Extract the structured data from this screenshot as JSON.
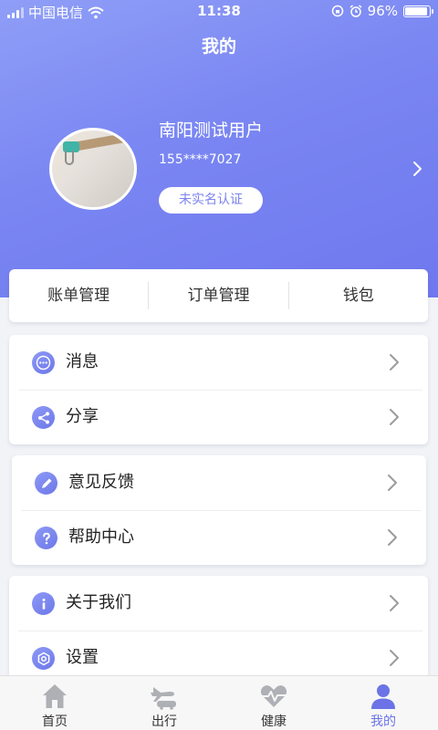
{
  "status_bar": {
    "carrier": "中国电信",
    "time": "11:38",
    "battery": "96%"
  },
  "header": {
    "title": "我的",
    "username": "南阳测试用户",
    "phone": "155****7027",
    "verify_label": "未实名认证"
  },
  "quick_actions": [
    {
      "label": "账单管理"
    },
    {
      "label": "订单管理"
    },
    {
      "label": "钱包"
    }
  ],
  "menu_groups": [
    {
      "items": [
        {
          "label": "消息",
          "icon": "message-icon"
        },
        {
          "label": "分享",
          "icon": "share-icon"
        }
      ]
    },
    {
      "items": [
        {
          "label": "意见反馈",
          "icon": "edit-icon"
        },
        {
          "label": "帮助中心",
          "icon": "help-icon"
        }
      ]
    },
    {
      "items": [
        {
          "label": "关于我们",
          "icon": "info-icon"
        },
        {
          "label": "设置",
          "icon": "settings-icon"
        }
      ]
    }
  ],
  "tabbar": [
    {
      "label": "首页",
      "icon": "home-icon",
      "active": false
    },
    {
      "label": "出行",
      "icon": "travel-icon",
      "active": false
    },
    {
      "label": "健康",
      "icon": "health-icon",
      "active": false
    },
    {
      "label": "我的",
      "icon": "profile-icon",
      "active": true
    }
  ],
  "colors": {
    "accent": "#7b84ee",
    "header_gradient_start": "#8f9ef7",
    "header_gradient_end": "#6f78ee",
    "tab_inactive_icon": "#aeb0b5"
  }
}
